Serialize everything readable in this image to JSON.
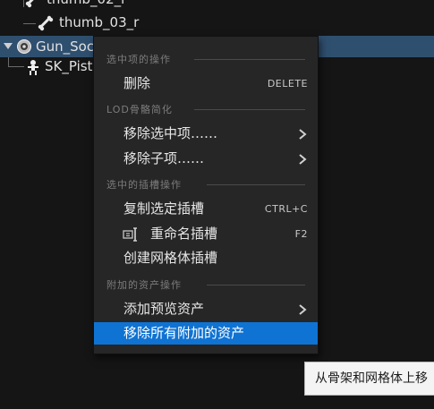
{
  "tree": {
    "rows": [
      {
        "label": "thumb_02_r",
        "icon": "bone-icon"
      },
      {
        "label": "thumb_03_r",
        "icon": "bone-icon"
      },
      {
        "label": "Gun_Soc",
        "icon": "socket-icon"
      },
      {
        "label": "SK_Pist",
        "icon": "skeletal-mesh-icon"
      }
    ],
    "selected_row_color": "#2f4f6f"
  },
  "menu": {
    "sections": [
      {
        "title": "选中项的操作",
        "items": [
          {
            "label": "删除",
            "shortcut": "DELETE"
          }
        ]
      },
      {
        "title": "LOD骨骼简化",
        "items": [
          {
            "label": "移除选中项……",
            "submenu": true
          },
          {
            "label": "移除子项……",
            "submenu": true
          }
        ]
      },
      {
        "title": "选中的插槽操作",
        "items": [
          {
            "label": "复制选定插槽",
            "shortcut": "CTRL+C"
          },
          {
            "label": "重命名插槽",
            "shortcut": "F2",
            "icon": "rename-icon"
          },
          {
            "label": "创建网格体插槽"
          }
        ]
      },
      {
        "title": "附加的资产操作",
        "items": [
          {
            "label": "添加预览资产",
            "submenu": true
          },
          {
            "label": "移除所有附加的资产",
            "highlighted": true
          }
        ]
      }
    ],
    "highlight_color": "#0f73d3"
  },
  "tooltip": {
    "text": "从骨架和网格体上移"
  }
}
